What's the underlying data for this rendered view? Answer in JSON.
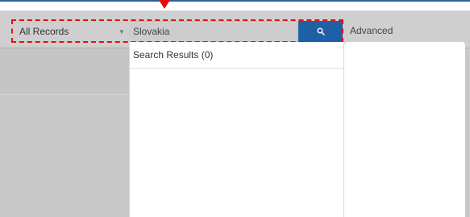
{
  "search_bar": {
    "scope_value": "All Records",
    "query_value": "Slovakia",
    "advanced_label": "Advanced"
  },
  "results": {
    "title": "Search Results (0)"
  },
  "colors": {
    "accent": "#1f5fa6",
    "highlight": "#e01010",
    "toolbar_bg": "#cfcfcf"
  },
  "icons": {
    "search_button": "search-icon",
    "scope_dropdown": "chevron-down-icon",
    "marker": "arrow-down-marker-icon"
  }
}
